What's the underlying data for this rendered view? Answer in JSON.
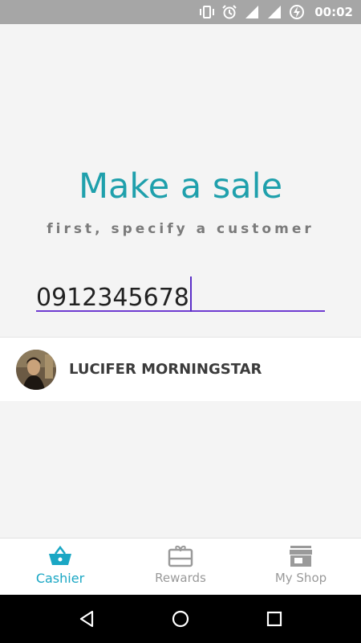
{
  "status_bar": {
    "time": "00:02",
    "icons": [
      "vibrate-icon",
      "alarm-icon",
      "signal-icon",
      "signal-icon",
      "battery-charging-icon"
    ]
  },
  "main": {
    "title": "Make a sale",
    "subtitle": "first, specify a customer",
    "phone_field": {
      "value": "0912345678"
    },
    "result": {
      "name": "LUCIFER MORNINGSTAR",
      "avatar": "avatar-photo"
    }
  },
  "bottom_nav": {
    "items": [
      {
        "label": "Cashier",
        "icon": "basket-icon",
        "active": true
      },
      {
        "label": "Rewards",
        "icon": "gift-card-icon",
        "active": false
      },
      {
        "label": "My Shop",
        "icon": "storefront-icon",
        "active": false
      }
    ]
  },
  "system_nav": {
    "buttons": [
      "back-icon",
      "home-icon",
      "recents-icon"
    ]
  },
  "colors": {
    "accent": "#1fa0ac",
    "nav_active": "#1aa7c4",
    "field_underline": "#6f3cd1",
    "status_bar": "#a6a6a6"
  }
}
